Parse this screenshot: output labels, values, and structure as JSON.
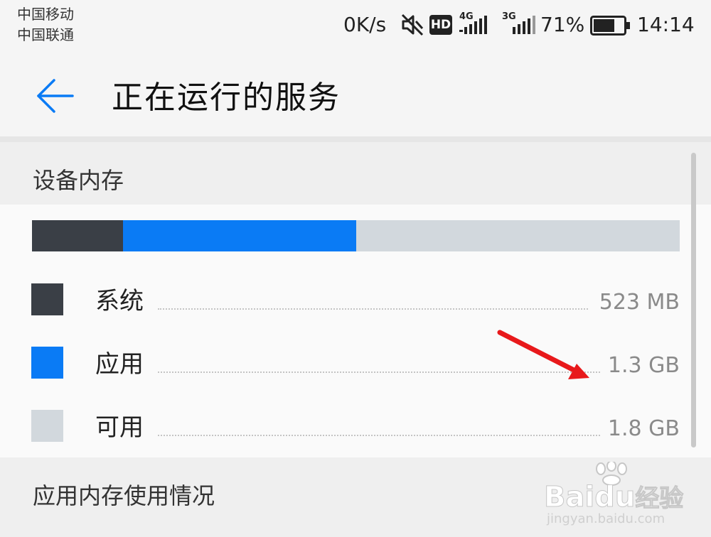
{
  "status_bar": {
    "carrier_1": "中国移动",
    "carrier_2": "中国联通",
    "network_speed": "0K/s",
    "hd_badge": "HD",
    "signal_1_type": "4G",
    "signal_2_type": "3G",
    "battery_percent": "71%",
    "battery_level": 0.71,
    "time": "14:14"
  },
  "app_bar": {
    "back_icon": "arrow-left-icon",
    "title": "正在运行的服务"
  },
  "device_memory": {
    "section_title": "设备内存",
    "usage_bar": [
      {
        "name": "系统",
        "color": "#3a3f46",
        "fraction": 0.14
      },
      {
        "name": "应用",
        "color": "#0a7bf5",
        "fraction": 0.36
      },
      {
        "name": "可用",
        "color": "#d2d8dd",
        "fraction": 0.5
      }
    ],
    "rows": [
      {
        "label": "系统",
        "value": "523 MB",
        "color": "#3a3f46"
      },
      {
        "label": "应用",
        "value": "1.3 GB",
        "color": "#0a7bf5"
      },
      {
        "label": "可用",
        "value": "1.8 GB",
        "color": "#d2d8dd"
      }
    ]
  },
  "app_memory": {
    "section_title": "应用内存使用情况"
  },
  "annotation": {
    "arrow_color": "#e8191b"
  },
  "watermark": {
    "brand": "Bai",
    "brand_mid": "du",
    "brand_suffix": "经验",
    "url": "jingyan.baidu.com"
  }
}
